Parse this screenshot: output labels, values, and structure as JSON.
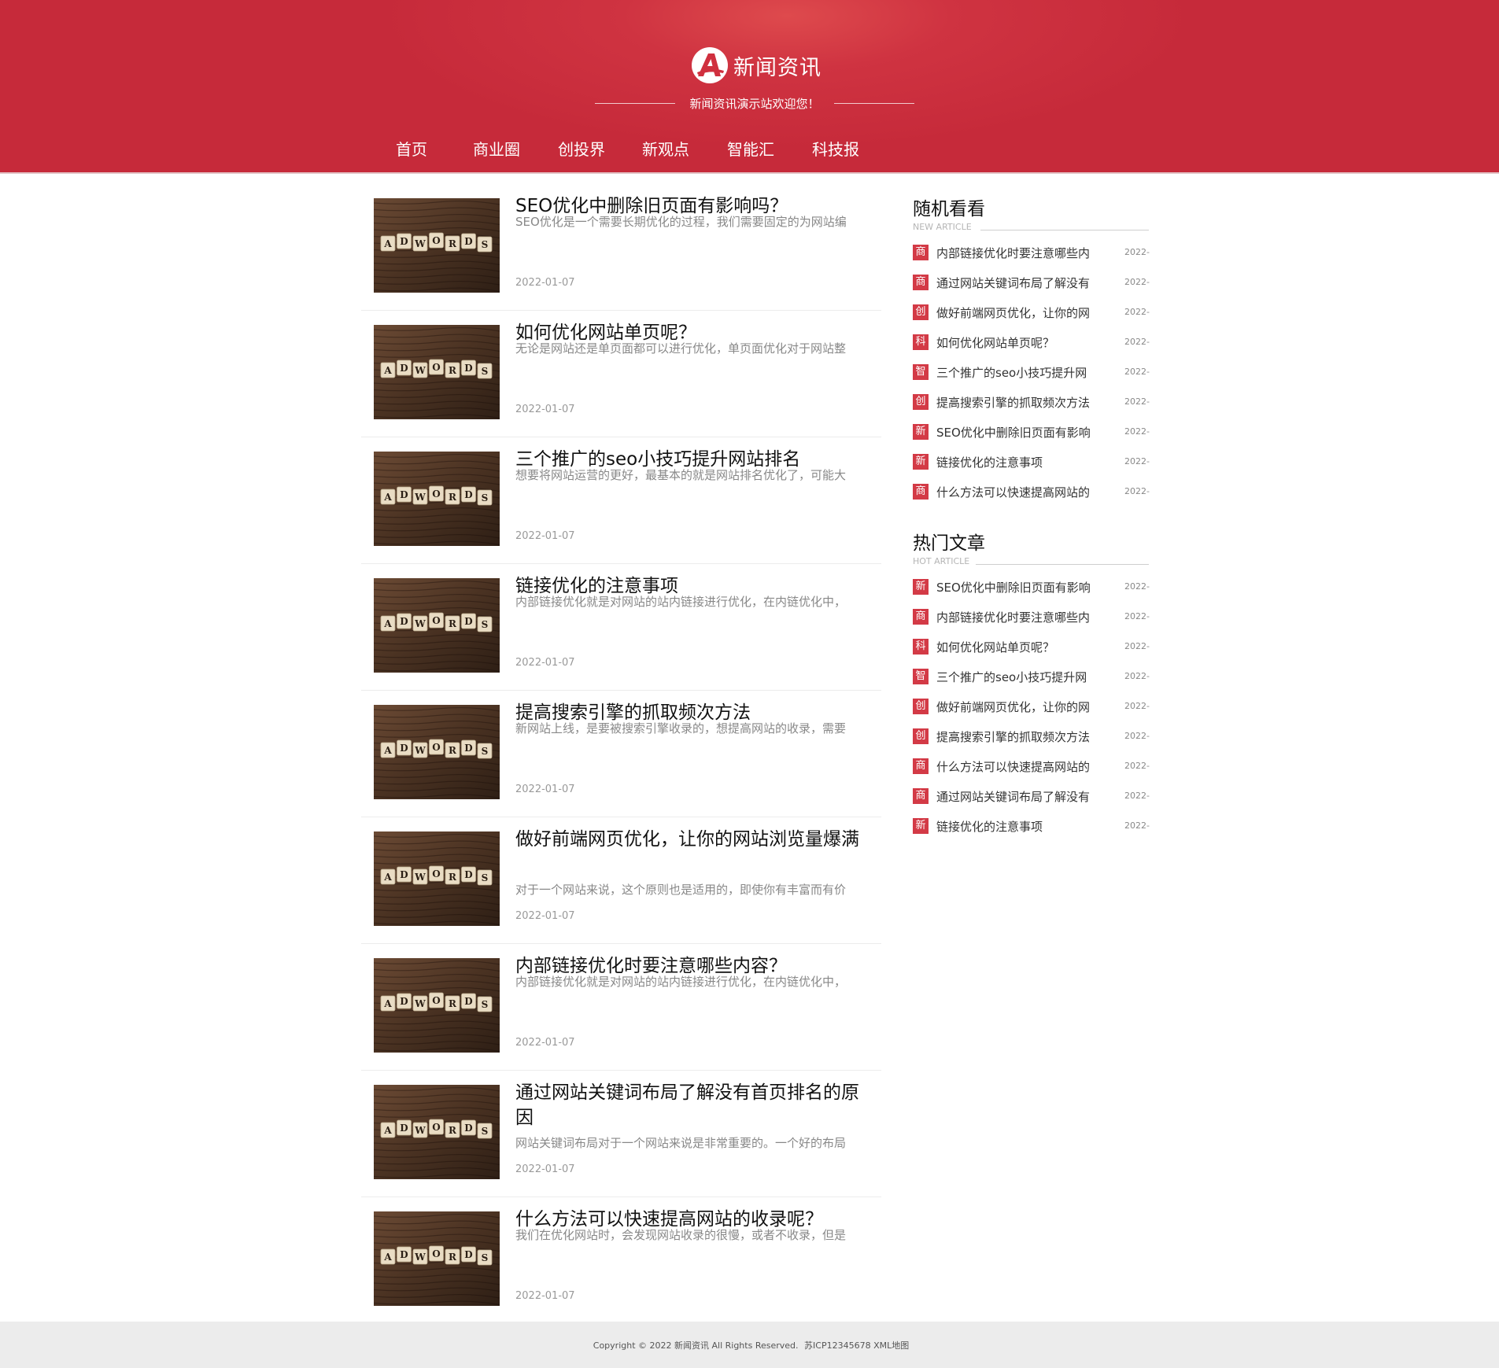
{
  "header": {
    "brand": "新闻资讯",
    "slogan": "新闻资讯演示站欢迎您！",
    "nav": [
      "首页",
      "商业圈",
      "创投界",
      "新观点",
      "智能汇",
      "科技报"
    ]
  },
  "thumbnail_letters": [
    "A",
    "D",
    "W",
    "O",
    "R",
    "D",
    "S"
  ],
  "articles": [
    {
      "title": "SEO优化中删除旧页面有影响吗？",
      "desc": "SEO优化是一个需要长期优化的过程，我们需要固定的为网站编",
      "date": "2022-01-07"
    },
    {
      "title": "如何优化网站单页呢？",
      "desc": "无论是网站还是单页面都可以进行优化，单页面优化对于网站整",
      "date": "2022-01-07"
    },
    {
      "title": "三个推广的seo小技巧提升网站排名",
      "desc": "想要将网站运营的更好，最基本的就是网站排名优化了，可能大",
      "date": "2022-01-07"
    },
    {
      "title": "链接优化的注意事项",
      "desc": "内部链接优化就是对网站的站内链接进行优化，在内链优化中，",
      "date": "2022-01-07"
    },
    {
      "title": "提高搜索引擎的抓取频次方法",
      "desc": "新网站上线，是要被搜索引擎收录的，想提高网站的收录，需要",
      "date": "2022-01-07"
    },
    {
      "title": "做好前端网页优化，让你的网站浏览量爆满",
      "desc": "对于一个网站来说，这个原则也是适用的，即使你有丰富而有价",
      "date": "2022-01-07"
    },
    {
      "title": "内部链接优化时要注意哪些内容？",
      "desc": "内部链接优化就是对网站的站内链接进行优化，在内链优化中，",
      "date": "2022-01-07"
    },
    {
      "title": "通过网站关键词布局了解没有首页排名的原因",
      "desc": "网站关键词布局对于一个网站来说是非常重要的。一个好的布局",
      "date": "2022-01-07"
    },
    {
      "title": "什么方法可以快速提高网站的收录呢？",
      "desc": "我们在优化网站时，会发现网站收录的很慢，或者不收录，但是",
      "date": "2022-01-07"
    }
  ],
  "sidebar": {
    "random": {
      "title": "随机看看",
      "subtitle": "NEW ARTICLE",
      "items": [
        {
          "tag": "商",
          "text": "内部链接优化时要注意哪些内",
          "date": "2022-"
        },
        {
          "tag": "商",
          "text": "通过网站关键词布局了解没有",
          "date": "2022-"
        },
        {
          "tag": "创",
          "text": "做好前端网页优化，让你的网",
          "date": "2022-"
        },
        {
          "tag": "科",
          "text": "如何优化网站单页呢？",
          "date": "2022-"
        },
        {
          "tag": "智",
          "text": "三个推广的seo小技巧提升网",
          "date": "2022-"
        },
        {
          "tag": "创",
          "text": "提高搜索引擎的抓取频次方法",
          "date": "2022-"
        },
        {
          "tag": "新",
          "text": "SEO优化中删除旧页面有影响",
          "date": "2022-"
        },
        {
          "tag": "新",
          "text": "链接优化的注意事项",
          "date": "2022-"
        },
        {
          "tag": "商",
          "text": "什么方法可以快速提高网站的",
          "date": "2022-"
        }
      ]
    },
    "hot": {
      "title": "热门文章",
      "subtitle": "HOT ARTICLE",
      "items": [
        {
          "tag": "新",
          "text": "SEO优化中删除旧页面有影响",
          "date": "2022-"
        },
        {
          "tag": "商",
          "text": "内部链接优化时要注意哪些内",
          "date": "2022-"
        },
        {
          "tag": "科",
          "text": "如何优化网站单页呢？",
          "date": "2022-"
        },
        {
          "tag": "智",
          "text": "三个推广的seo小技巧提升网",
          "date": "2022-"
        },
        {
          "tag": "创",
          "text": "做好前端网页优化，让你的网",
          "date": "2022-"
        },
        {
          "tag": "创",
          "text": "提高搜索引擎的抓取频次方法",
          "date": "2022-"
        },
        {
          "tag": "商",
          "text": "什么方法可以快速提高网站的",
          "date": "2022-"
        },
        {
          "tag": "商",
          "text": "通过网站关键词布局了解没有",
          "date": "2022-"
        },
        {
          "tag": "新",
          "text": "链接优化的注意事项",
          "date": "2022-"
        }
      ]
    }
  },
  "footer": {
    "copyright": "Copyright © 2022 新闻资讯 All Rights Reserved.",
    "icp": "苏ICP12345678",
    "sitemap": "XML地图"
  }
}
